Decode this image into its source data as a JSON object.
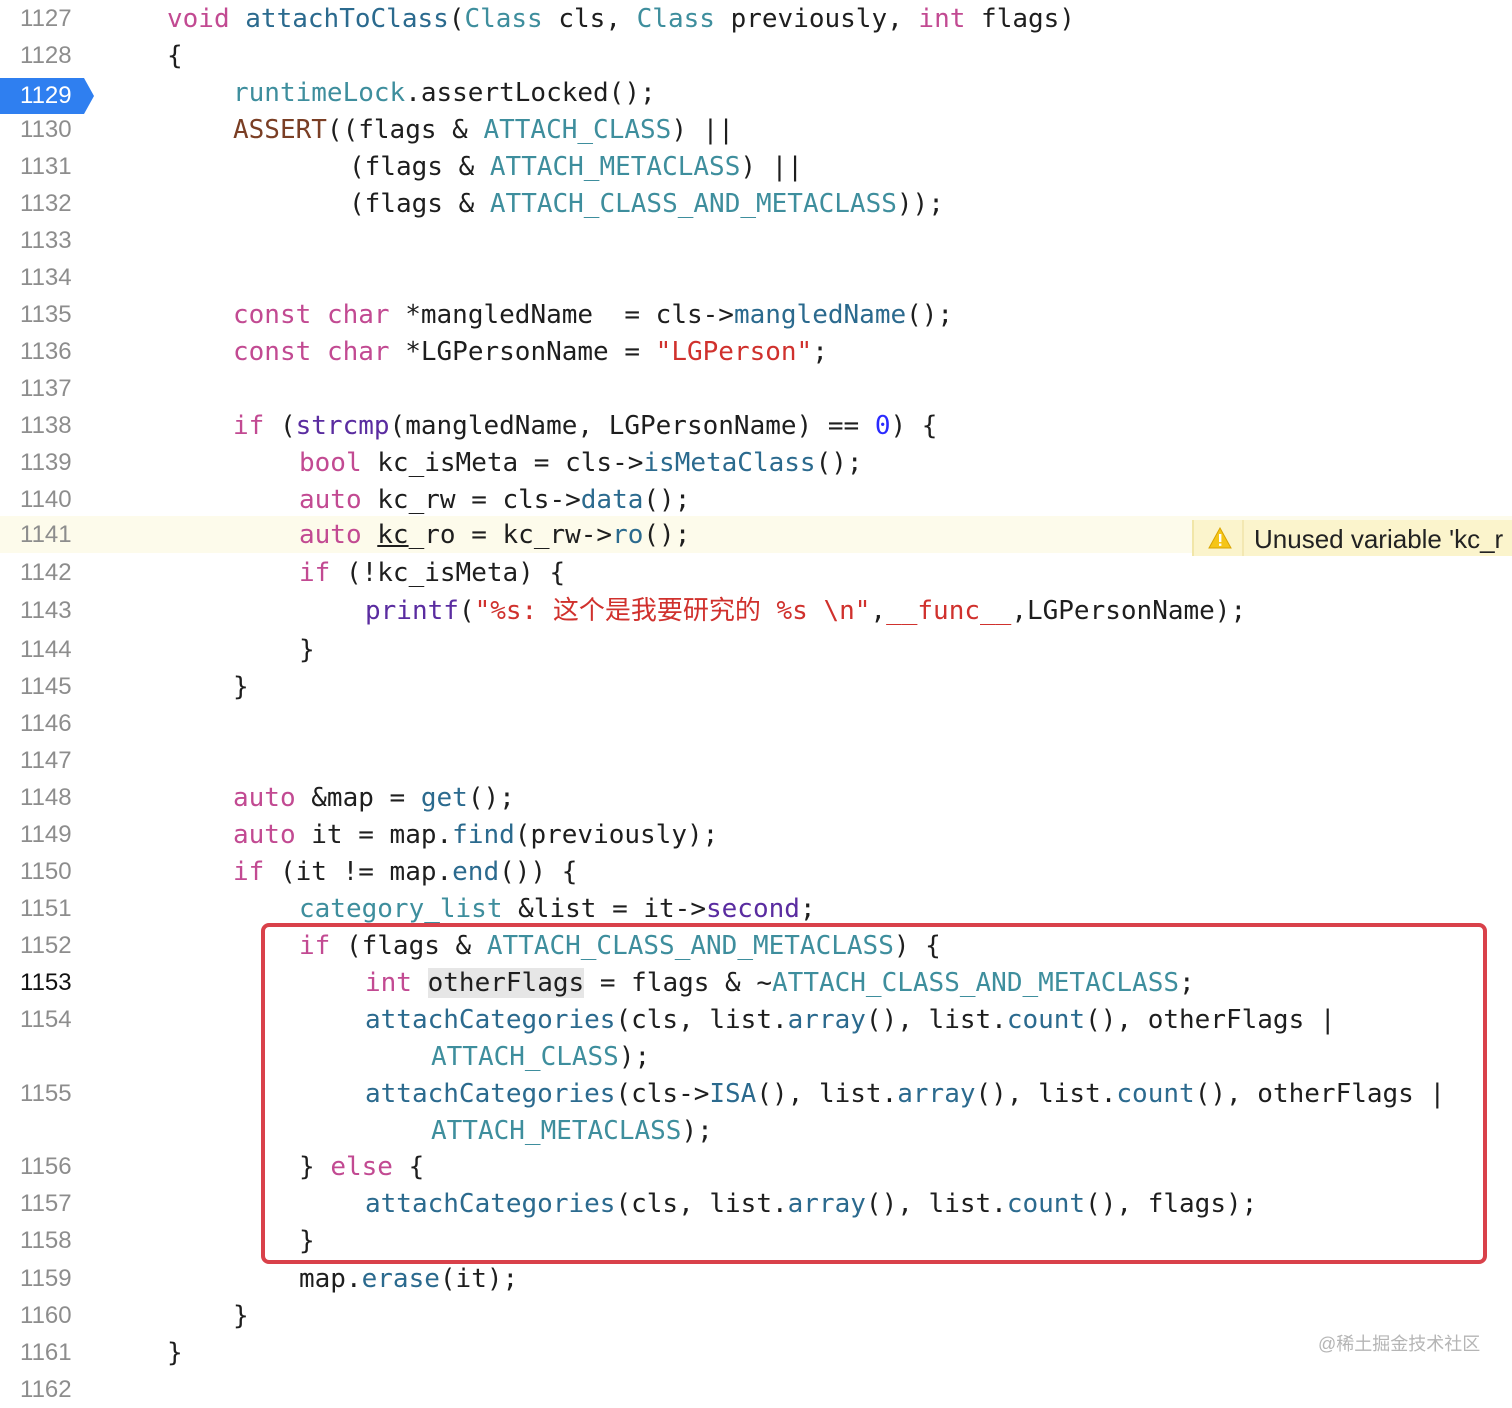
{
  "breakpoint": {
    "line": "1129"
  },
  "warning": {
    "text": "Unused variable 'kc_r"
  },
  "watermark": "@稀土掘金技术社区",
  "lines": [
    {
      "num": "1127",
      "segs": [
        {
          "t": "void",
          "c": "kw"
        },
        {
          "t": " "
        },
        {
          "t": "attachToClass",
          "c": "fn"
        },
        {
          "t": "("
        },
        {
          "t": "Class",
          "c": "type"
        },
        {
          "t": " cls, "
        },
        {
          "t": "Class",
          "c": "type"
        },
        {
          "t": " previously, "
        },
        {
          "t": "int",
          "c": "kw"
        },
        {
          "t": " flags)"
        }
      ]
    },
    {
      "num": "1128",
      "segs": [
        {
          "t": "{"
        }
      ]
    },
    {
      "num": "1129",
      "segs": [
        {
          "t": "runtimeLock",
          "c": "type"
        },
        {
          "t": ".assertLocked();"
        }
      ]
    },
    {
      "num": "1130",
      "segs": [
        {
          "t": "ASSERT",
          "c": "macro"
        },
        {
          "t": "((flags & "
        },
        {
          "t": "ATTACH_CLASS",
          "c": "type"
        },
        {
          "t": ") ||"
        }
      ]
    },
    {
      "num": "1131",
      "segs": [
        {
          "t": "(flags & "
        },
        {
          "t": "ATTACH_METACLASS",
          "c": "type"
        },
        {
          "t": ") ||"
        }
      ]
    },
    {
      "num": "1132",
      "segs": [
        {
          "t": "(flags & "
        },
        {
          "t": "ATTACH_CLASS_AND_METACLASS",
          "c": "type"
        },
        {
          "t": "));"
        }
      ]
    },
    {
      "num": "1133",
      "segs": []
    },
    {
      "num": "1134",
      "segs": []
    },
    {
      "num": "1135",
      "segs": [
        {
          "t": "const",
          "c": "kw"
        },
        {
          "t": " "
        },
        {
          "t": "char",
          "c": "kw"
        },
        {
          "t": " *mangledName  = cls->"
        },
        {
          "t": "mangledName",
          "c": "mem"
        },
        {
          "t": "();"
        }
      ]
    },
    {
      "num": "1136",
      "segs": [
        {
          "t": "const",
          "c": "kw"
        },
        {
          "t": " "
        },
        {
          "t": "char",
          "c": "kw"
        },
        {
          "t": " *LGPersonName = "
        },
        {
          "t": "\"LGPerson\"",
          "c": "str"
        },
        {
          "t": ";"
        }
      ]
    },
    {
      "num": "1137",
      "segs": []
    },
    {
      "num": "1138",
      "segs": [
        {
          "t": "if",
          "c": "kw"
        },
        {
          "t": " ("
        },
        {
          "t": "strcmp",
          "c": "call"
        },
        {
          "t": "(mangledName, LGPersonName) == "
        },
        {
          "t": "0",
          "c": "num"
        },
        {
          "t": ") {"
        }
      ]
    },
    {
      "num": "1139",
      "segs": [
        {
          "t": "bool",
          "c": "kw"
        },
        {
          "t": " kc_isMeta = cls->"
        },
        {
          "t": "isMetaClass",
          "c": "mem"
        },
        {
          "t": "();"
        }
      ]
    },
    {
      "num": "1140",
      "segs": [
        {
          "t": "auto",
          "c": "kw"
        },
        {
          "t": " kc_rw = cls->"
        },
        {
          "t": "data",
          "c": "mem"
        },
        {
          "t": "();"
        }
      ]
    },
    {
      "num": "1141",
      "segs": [
        {
          "t": "auto",
          "c": "kw"
        },
        {
          "t": " "
        },
        {
          "t": "kc",
          "c": "u"
        },
        {
          "t": "_ro = kc_rw->"
        },
        {
          "t": "ro",
          "c": "mem"
        },
        {
          "t": "();"
        }
      ]
    },
    {
      "num": "1142",
      "segs": [
        {
          "t": "if",
          "c": "kw"
        },
        {
          "t": " (!kc_isMeta) {"
        }
      ]
    },
    {
      "num": "1143",
      "segs": [
        {
          "t": "printf",
          "c": "call"
        },
        {
          "t": "("
        },
        {
          "t": "\"%s: 这个是我要研究的 %s \\n\"",
          "c": "str"
        },
        {
          "t": ","
        },
        {
          "t": "__func__",
          "c": "str"
        },
        {
          "t": ",LGPersonName);"
        }
      ]
    },
    {
      "num": "1144",
      "segs": [
        {
          "t": "}"
        }
      ]
    },
    {
      "num": "1145",
      "segs": [
        {
          "t": "}"
        }
      ]
    },
    {
      "num": "1146",
      "segs": []
    },
    {
      "num": "1147",
      "segs": []
    },
    {
      "num": "1148",
      "segs": [
        {
          "t": "auto",
          "c": "kw"
        },
        {
          "t": " &map = "
        },
        {
          "t": "get",
          "c": "mem"
        },
        {
          "t": "();"
        }
      ]
    },
    {
      "num": "1149",
      "segs": [
        {
          "t": "auto",
          "c": "kw"
        },
        {
          "t": " it = map."
        },
        {
          "t": "find",
          "c": "mem"
        },
        {
          "t": "(previously);"
        }
      ]
    },
    {
      "num": "1150",
      "segs": [
        {
          "t": "if",
          "c": "kw"
        },
        {
          "t": " (it != map."
        },
        {
          "t": "end",
          "c": "mem"
        },
        {
          "t": "()) {"
        }
      ]
    },
    {
      "num": "1151",
      "segs": [
        {
          "t": "category_list",
          "c": "type"
        },
        {
          "t": " &list = it->"
        },
        {
          "t": "second",
          "c": "call"
        },
        {
          "t": ";"
        }
      ]
    },
    {
      "num": "1152",
      "segs": [
        {
          "t": "if",
          "c": "kw"
        },
        {
          "t": " (flags & "
        },
        {
          "t": "ATTACH_CLASS_AND_METACLASS",
          "c": "type"
        },
        {
          "t": ") {"
        }
      ]
    },
    {
      "num": "1153",
      "segs": [
        {
          "t": "int",
          "c": "kw"
        },
        {
          "t": " "
        },
        {
          "t": "otherFlags",
          "c": "hl"
        },
        {
          "t": " = flags & ~"
        },
        {
          "t": "ATTACH_CLASS_AND_METACLASS",
          "c": "type"
        },
        {
          "t": ";"
        }
      ]
    },
    {
      "num": "1154",
      "segs": [
        {
          "t": "attachCategories",
          "c": "mem"
        },
        {
          "t": "(cls, list."
        },
        {
          "t": "array",
          "c": "mem"
        },
        {
          "t": "(), list."
        },
        {
          "t": "count",
          "c": "mem"
        },
        {
          "t": "(), otherFlags |"
        }
      ]
    },
    {
      "num": "",
      "segs": [
        {
          "t": "ATTACH_CLASS",
          "c": "type"
        },
        {
          "t": ");"
        }
      ]
    },
    {
      "num": "1155",
      "segs": [
        {
          "t": "attachCategories",
          "c": "mem"
        },
        {
          "t": "(cls->"
        },
        {
          "t": "ISA",
          "c": "mem"
        },
        {
          "t": "(), list."
        },
        {
          "t": "array",
          "c": "mem"
        },
        {
          "t": "(), list."
        },
        {
          "t": "count",
          "c": "mem"
        },
        {
          "t": "(), otherFlags |"
        }
      ]
    },
    {
      "num": "",
      "segs": [
        {
          "t": "ATTACH_METACLASS",
          "c": "type"
        },
        {
          "t": ");"
        }
      ]
    },
    {
      "num": "1156",
      "segs": [
        {
          "t": "} "
        },
        {
          "t": "else",
          "c": "kw"
        },
        {
          "t": " {"
        }
      ]
    },
    {
      "num": "1157",
      "segs": [
        {
          "t": "attachCategories",
          "c": "mem"
        },
        {
          "t": "(cls, list."
        },
        {
          "t": "array",
          "c": "mem"
        },
        {
          "t": "(), list."
        },
        {
          "t": "count",
          "c": "mem"
        },
        {
          "t": "(), flags);"
        }
      ]
    },
    {
      "num": "1158",
      "segs": [
        {
          "t": "}"
        }
      ]
    },
    {
      "num": "1159",
      "segs": [
        {
          "t": "map."
        },
        {
          "t": "erase",
          "c": "mem"
        },
        {
          "t": "(it);"
        }
      ]
    },
    {
      "num": "1160",
      "segs": [
        {
          "t": "}"
        }
      ]
    },
    {
      "num": "1161",
      "segs": [
        {
          "t": "}"
        }
      ]
    },
    {
      "num": "1162",
      "segs": []
    }
  ]
}
